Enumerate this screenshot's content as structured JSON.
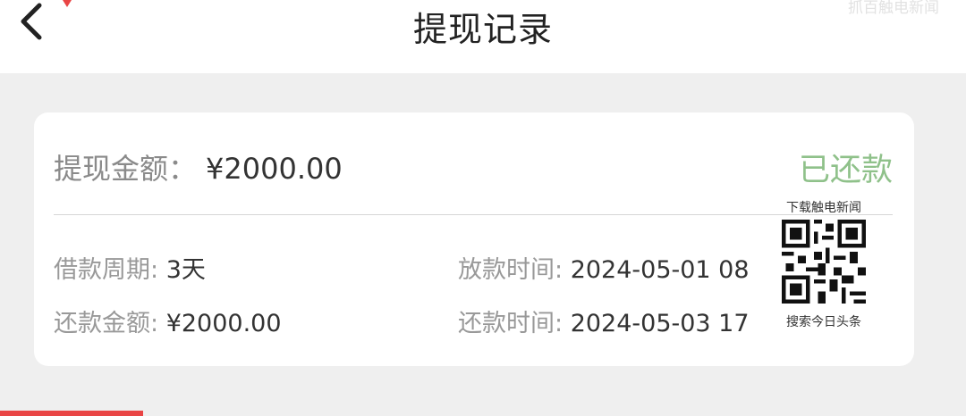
{
  "header": {
    "title": "提现记录",
    "back_icon": "chevron-left-icon",
    "watermark": "抓百触电新闻"
  },
  "record": {
    "amount_label": "提现金额：",
    "amount_value": "¥2000.00",
    "status": "已还款",
    "status_color": "#8fc18a",
    "period_label": "借款周期: ",
    "period_value": "3天",
    "repay_amount_label": "还款金额: ",
    "repay_amount_value": "¥2000.00",
    "disburse_time_label": "放款时间: ",
    "disburse_time_value": "2024-05-01 08",
    "repay_time_label": "还款时间: ",
    "repay_time_value": "2024-05-03 17"
  },
  "overlay": {
    "qr_top_text": "下载触电新闻",
    "qr_bottom_text": "搜索今日头条"
  },
  "colors": {
    "background": "#efefef",
    "card": "#ffffff",
    "accent": "#e94545"
  }
}
